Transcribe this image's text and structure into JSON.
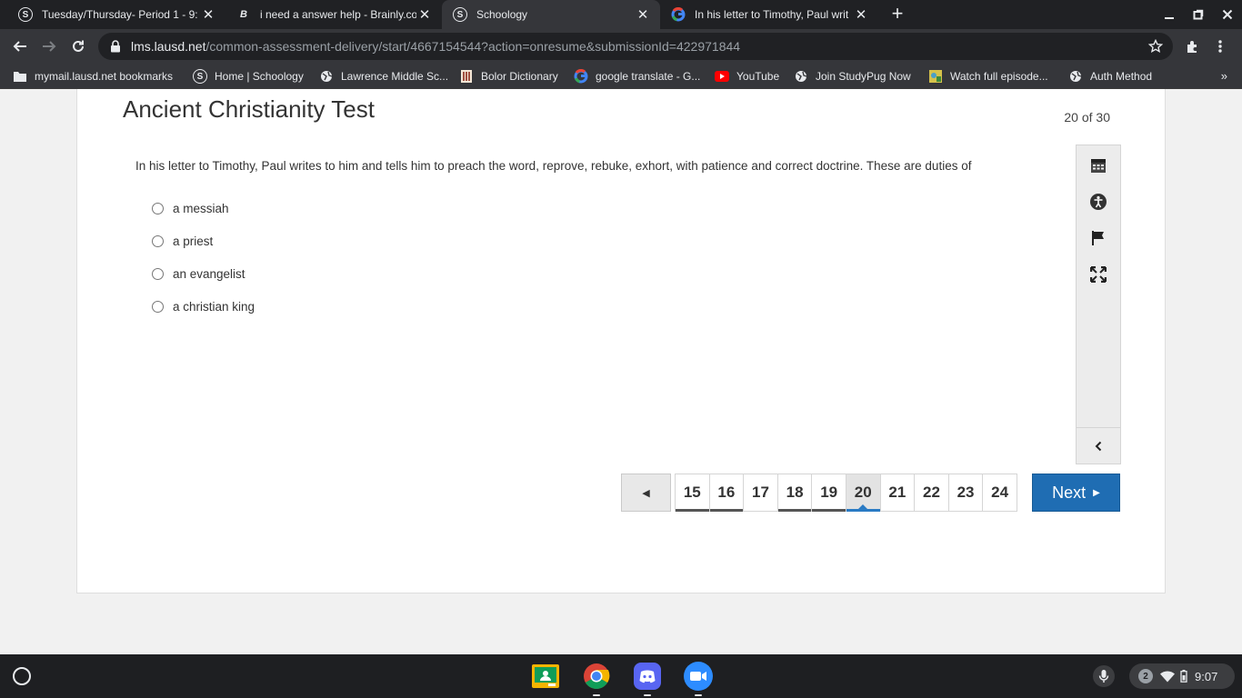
{
  "browser": {
    "tabs": [
      {
        "title": "Tuesday/Thursday- Period 1 - 9:",
        "icon": "schoology-icon",
        "active": false
      },
      {
        "title": "i need a answer help - Brainly.co",
        "icon": "brainly-icon",
        "active": false
      },
      {
        "title": "Schoology",
        "icon": "schoology-icon",
        "active": true
      },
      {
        "title": "In his letter to Timothy, Paul writ",
        "icon": "google-icon",
        "active": false
      }
    ],
    "url_host": "lms.lausd.net",
    "url_path": "/common-assessment-delivery/start/4667154544?action=onresume&submissionId=422971844",
    "bookmarks": [
      {
        "label": "mymail.lausd.net bookmarks",
        "icon": "folder-icon"
      },
      {
        "label": "Home | Schoology",
        "icon": "schoology-icon"
      },
      {
        "label": "Lawrence Middle Sc...",
        "icon": "globe-icon"
      },
      {
        "label": "Bolor Dictionary",
        "icon": "dictionary-icon"
      },
      {
        "label": "google translate - G...",
        "icon": "google-icon"
      },
      {
        "label": "YouTube",
        "icon": "youtube-icon"
      },
      {
        "label": "Join StudyPug Now",
        "icon": "globe-icon"
      },
      {
        "label": "Watch full episode...",
        "icon": "video-icon"
      },
      {
        "label": "Auth Method",
        "icon": "globe-icon"
      }
    ]
  },
  "assessment": {
    "title": "Ancient Christianity Test",
    "progress": "20 of 30",
    "question": "In his letter to Timothy, Paul writes to him and tells him to preach the word, reprove, rebuke, exhort, with patience and correct doctrine. These are duties of",
    "choices": [
      "a messiah",
      "a priest",
      "an evangelist",
      "a christian king"
    ],
    "tools": [
      "calendar-icon",
      "accessibility-icon",
      "flag-icon",
      "fullscreen-icon"
    ],
    "pages": [
      "15",
      "16",
      "17",
      "18",
      "19",
      "20",
      "21",
      "22",
      "23",
      "24"
    ],
    "current_page": "20",
    "next_label": "Next",
    "accent_color": "#1f6db3"
  },
  "shelf": {
    "apps": [
      "classroom-icon",
      "chrome-icon",
      "discord-icon",
      "zoom-icon"
    ],
    "notification_count": "2",
    "time": "9:07"
  }
}
